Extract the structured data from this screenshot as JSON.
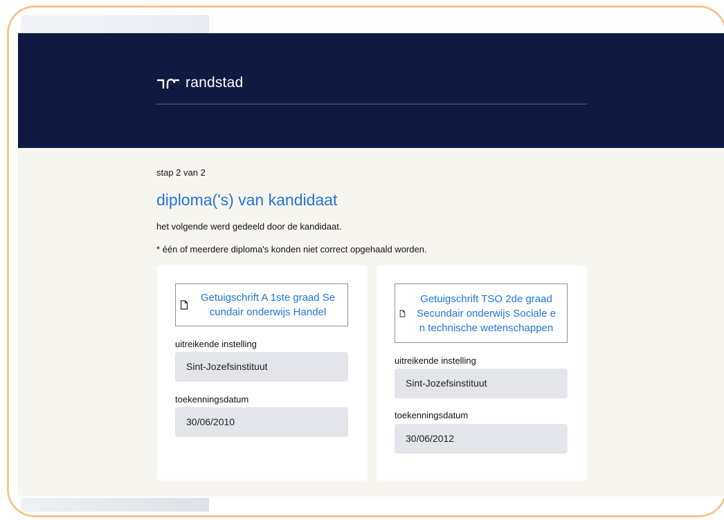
{
  "brand": {
    "name": "randstad"
  },
  "step": {
    "text": "stap 2 van 2"
  },
  "page": {
    "title": "diploma('s) van kandidaat",
    "intro": "het volgende werd gedeeld door de kandidaat.",
    "warning": "* één of meerdere diploma's konden niet correct opgehaald worden."
  },
  "diplomas": [
    {
      "name_lines": [
        "Getuigschrift A 1ste graad Se",
        "cundair onderwijs Handel"
      ],
      "institution_label": "uitreikende instelling",
      "institution": "Sint-Jozefsinstituut",
      "date_label": "toekenningsdatum",
      "date": "30/06/2010",
      "icon": "file-icon"
    },
    {
      "name_lines": [
        "Getuigschrift TSO 2de graad",
        "Secundair onderwijs Sociale e",
        "n technische wetenschappen"
      ],
      "institution_label": "uitreikende instelling",
      "institution": "Sint-Jozefsinstituut",
      "date_label": "toekenningsdatum",
      "date": "30/06/2012",
      "icon": "file-icon"
    }
  ],
  "colors": {
    "header_bg": "#0f1941",
    "accent": "#2175d9",
    "content_bg": "#f7f5f0",
    "field_bg": "#e3e5ea"
  }
}
